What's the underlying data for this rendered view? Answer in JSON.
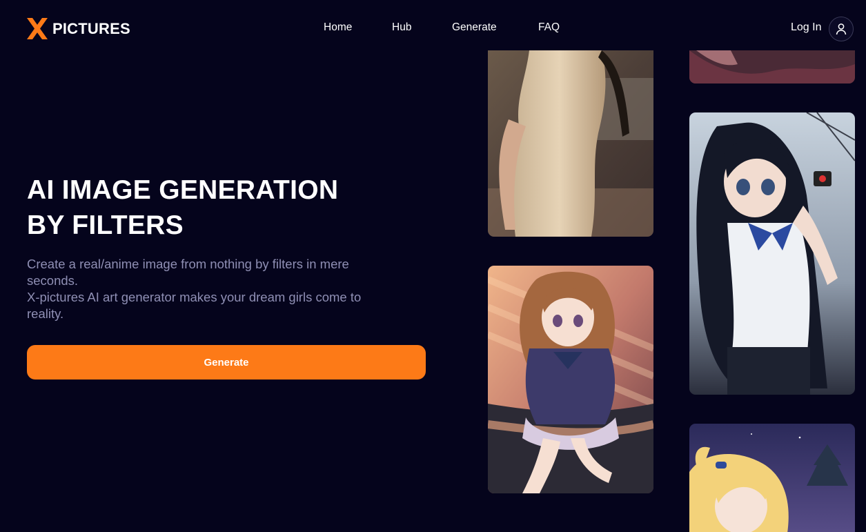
{
  "brand": {
    "name": "PICTURES",
    "mark_icon": "x-logo-icon",
    "accent_color": "#fd7a17"
  },
  "nav": {
    "items": [
      {
        "label": "Home"
      },
      {
        "label": "Hub"
      },
      {
        "label": "Generate"
      },
      {
        "label": "FAQ"
      }
    ]
  },
  "header": {
    "login_label": "Log In",
    "account_icon": "user-icon"
  },
  "hero": {
    "title_line1": "AI IMAGE GENERATION",
    "title_line2": "BY FILTERS",
    "desc_line1": "Create a real/anime image from nothing by filters in mere",
    "desc_line2": "seconds.",
    "desc_line3": "X-pictures AI art generator makes your dream girls come to",
    "desc_line4": "reality.",
    "cta_label": "Generate"
  },
  "colors": {
    "background": "#05041c",
    "text_muted": "#8f8fb4",
    "button": "#fd7a17"
  },
  "gallery": {
    "cards": [
      {
        "id": "card-lace-dress",
        "subject": "photo of woman in lace dress"
      },
      {
        "id": "card-top-right",
        "subject": "partially visible image"
      },
      {
        "id": "card-schoolgirl-dark-hair",
        "subject": "anime girl with long dark hair"
      },
      {
        "id": "card-sailor-uniform",
        "subject": "anime girl in sailor uniform sitting"
      },
      {
        "id": "card-blonde-night",
        "subject": "anime blonde girl at night"
      }
    ]
  }
}
